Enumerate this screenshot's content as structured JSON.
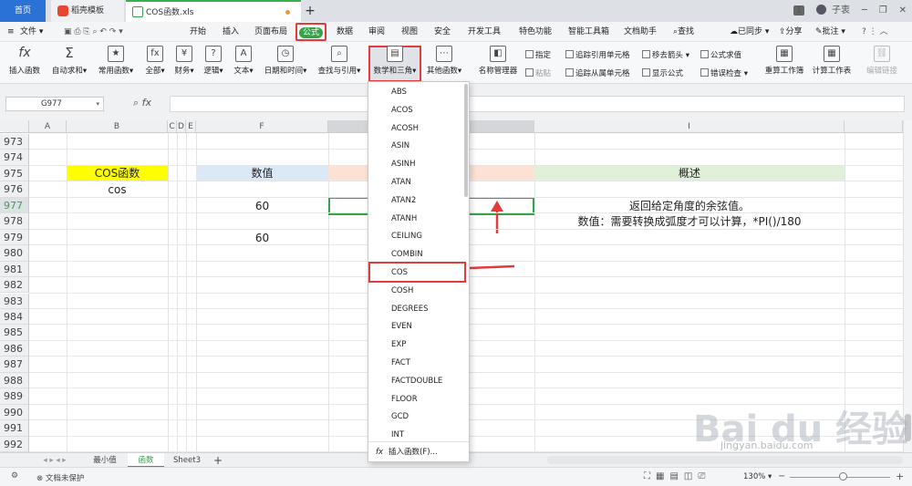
{
  "titlebar": {
    "home": "首页",
    "template_tab": "稻壳模板",
    "file_tab": "COS函数.xls",
    "new_tab": "+",
    "badge": "1",
    "user": "子衷"
  },
  "menubar": {
    "file": "文件",
    "items": [
      "开始",
      "插入",
      "页面布局",
      "公式",
      "数据",
      "审阅",
      "视图",
      "安全",
      "开发工具",
      "特色功能",
      "智能工具箱",
      "文档助手"
    ],
    "search": "查找",
    "sync": "已同步",
    "share": "分享",
    "annotate": "批注"
  },
  "toolbar": {
    "insert_function": "插入函数",
    "autosum": "自动求和",
    "common": "常用函数",
    "all": "全部",
    "finance": "财务",
    "logic": "逻辑",
    "text": "文本",
    "datetime": "日期和时间",
    "lookup": "查找与引用",
    "math": "数学和三角",
    "other": "其他函数",
    "name_manager": "名称管理器",
    "specify": "指定",
    "paste": "粘贴",
    "trace_precedents": "追踪引用单元格",
    "trace_dependents": "追踪从属单元格",
    "remove_arrows": "移去箭头",
    "show_formulas": "显示公式",
    "evaluate": "公式求值",
    "error_check": "错误检查",
    "recalc_sheet": "重算工作簿",
    "calc_sheet": "计算工作表",
    "edit_links": "编辑链接"
  },
  "formula_bar": {
    "name_box": "G977",
    "fx": "fx"
  },
  "columns": [
    "A",
    "B",
    "C",
    "D",
    "E",
    "F",
    "",
    "H",
    "I"
  ],
  "col_i": "I",
  "rows": [
    "973",
    "974",
    "975",
    "976",
    "977",
    "978",
    "979",
    "980",
    "981",
    "982",
    "983",
    "984",
    "985",
    "986",
    "987",
    "988",
    "989",
    "990",
    "991",
    "992"
  ],
  "cells": {
    "b975": "COS函数",
    "b976": "cos",
    "f975": "数值",
    "f977": "60",
    "f979": "60",
    "i975": "概述",
    "i977": "返回给定角度的余弦值。",
    "i978": "数值：需要转换成弧度才可以计算，*PI()/180"
  },
  "dropdown": {
    "items": [
      "ABS",
      "ACOS",
      "ACOSH",
      "ASIN",
      "ASINH",
      "ATAN",
      "ATAN2",
      "ATANH",
      "CEILING",
      "COMBIN",
      "COS",
      "COSH",
      "DEGREES",
      "EVEN",
      "EXP",
      "FACT",
      "FACTDOUBLE",
      "FLOOR",
      "GCD",
      "INT"
    ],
    "footer": "插入函数(F)..."
  },
  "sheets": [
    "最小值",
    "函数",
    "Sheet3"
  ],
  "status": {
    "protect": "文档未保护",
    "zoom": "130%"
  },
  "watermark": {
    "logo": "Bai du 经验",
    "url": "jingyan.baidu.com"
  },
  "colors": {
    "accent_green": "#36a348",
    "highlight_red": "#e23b3b",
    "yellow_fill": "#ffff00",
    "blue_fill": "#dbe9f7",
    "pink_fill": "#fde1d5",
    "green_fill": "#e0f0d9"
  }
}
